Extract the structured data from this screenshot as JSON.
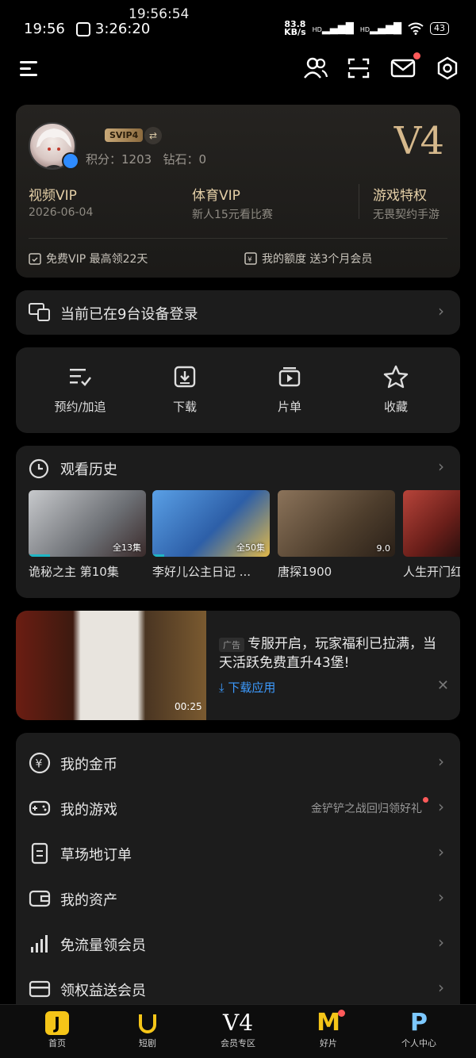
{
  "status": {
    "clock_top": "19:56:54",
    "time": "19:56",
    "timer": "3:26:20",
    "net_speed_top": "83.8",
    "net_speed_unit": "KB/s",
    "hd1": "HD",
    "hd2": "HD",
    "battery": "43"
  },
  "header": {
    "icons": [
      "menu-icon",
      "friends-icon",
      "scan-icon",
      "mail-icon",
      "settings-icon"
    ]
  },
  "vip": {
    "badge": "SVIP4",
    "swap_glyph": "⇄",
    "points": "积分：1203   钻石：0",
    "level": "V4",
    "columns": [
      {
        "title": "视频VIP",
        "sub": "2026-06-04"
      },
      {
        "title": "体育VIP",
        "sub": "新人15元看比赛"
      },
      {
        "title": "游戏特权",
        "sub": "无畏契约手游"
      }
    ],
    "footer": [
      {
        "label": "免费VIP 最高领22天"
      },
      {
        "label": "我的额度 送3个月会员"
      }
    ]
  },
  "devices": {
    "label": "当前已在9台设备登录",
    "chevron": "›"
  },
  "quick": [
    {
      "label": "预约/加追",
      "icon": "reserve-list-icon"
    },
    {
      "label": "下载",
      "icon": "download-icon"
    },
    {
      "label": "片单",
      "icon": "playlist-icon"
    },
    {
      "label": "收藏",
      "icon": "star-icon"
    }
  ],
  "history": {
    "title": "观看历史",
    "chevron": "›",
    "items": [
      {
        "title": "诡秘之主 第10集",
        "badge": "全13集",
        "progress": 0.18,
        "bg": "#8a8f96"
      },
      {
        "title": "李好儿公主日记 ...",
        "badge": "全50集",
        "progress": 0.1,
        "bg": "#3f7cc2"
      },
      {
        "title": "唐探1900",
        "badge": "9.0",
        "progress": 0.0,
        "bg": "#6e5a44"
      },
      {
        "title": "人生开门红",
        "badge": "",
        "progress": 0.0,
        "bg": "#7a2a24"
      }
    ]
  },
  "ad": {
    "tag": "广告",
    "text": "专服开启，玩家福利已拉满，当天活跃免费直升43堡!",
    "link": "⤓ 下载应用",
    "close": "✕",
    "duration": "00:25"
  },
  "menu": [
    {
      "label": "我的金币",
      "icon": "coin-icon",
      "right": ""
    },
    {
      "label": "我的游戏",
      "icon": "gamepad-icon",
      "right": "金铲铲之战回归领好礼"
    },
    {
      "label": "草场地订单",
      "icon": "order-icon",
      "right": ""
    },
    {
      "label": "我的资产",
      "icon": "wallet-icon",
      "right": ""
    },
    {
      "label": "免流量领会员",
      "icon": "signal-icon",
      "right": ""
    },
    {
      "label": "领权益送会员",
      "icon": "card-icon",
      "right": ""
    }
  ],
  "tabs": [
    {
      "label": "首页",
      "icon_text": "J"
    },
    {
      "label": "短剧",
      "icon_text": ""
    },
    {
      "label": "会员专区",
      "icon_text": "V4"
    },
    {
      "label": "好片",
      "icon_text": "M"
    },
    {
      "label": "个人中心",
      "icon_text": "P"
    }
  ],
  "colors": {
    "accent_gold": "#e4cfa7",
    "link_blue": "#3d9bff",
    "red_dot": "#ff5a5a"
  }
}
